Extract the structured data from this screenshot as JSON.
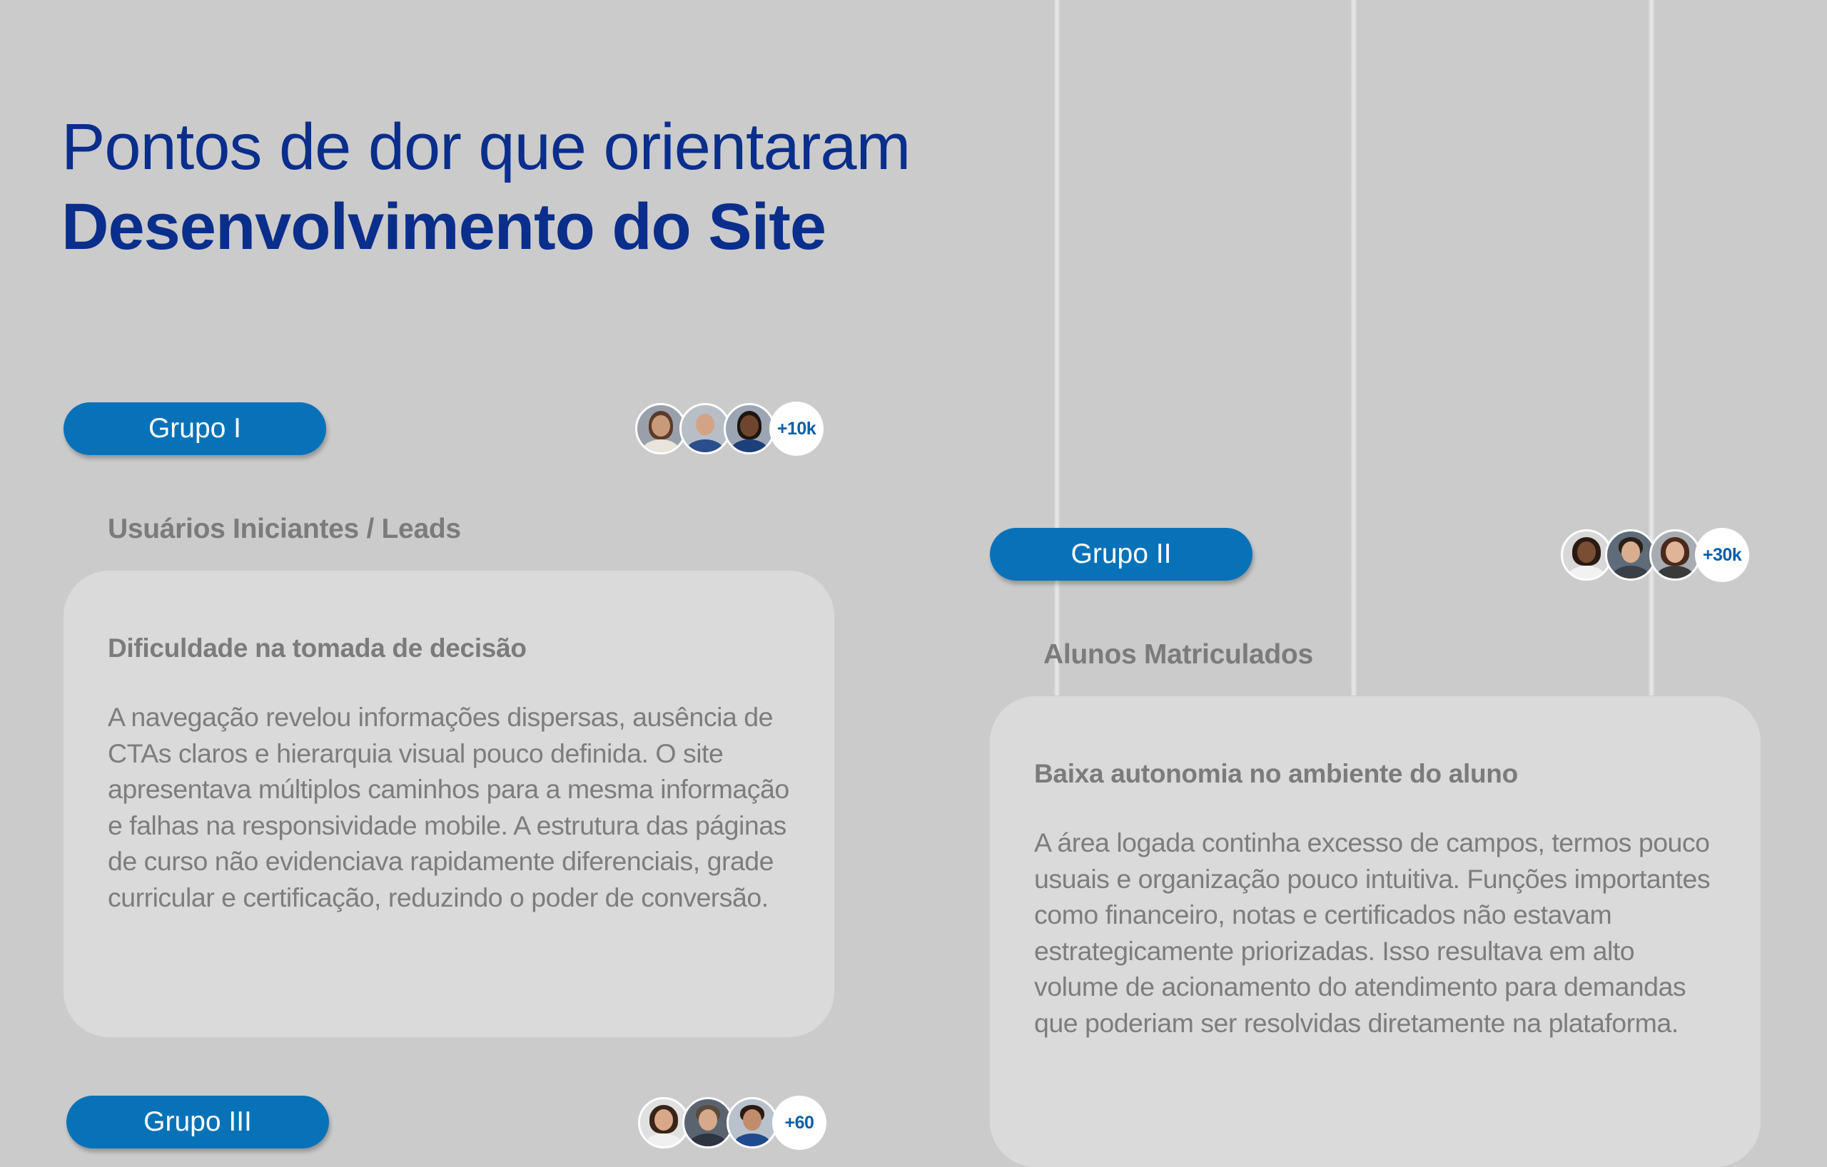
{
  "title": {
    "line1": "Pontos de dor que orientaram",
    "line2": "Desenvolvimento do Site"
  },
  "groups": [
    {
      "label": "Grupo I",
      "count": "+10k",
      "audience": "Usuários Iniciantes / Leads",
      "card_title": "Dificuldade na tomada de decisão",
      "card_body": "A navegação revelou informações dispersas, ausência de CTAs claros e hierarquia visual pouco definida. O site apresentava múltiplos caminhos para a mesma informação e falhas na responsividade mobile. A estrutura das páginas de curso não evidenciava rapidamente diferenciais, grade curricular e certificação, reduzindo o poder de conversão."
    },
    {
      "label": "Grupo II",
      "count": "+30k",
      "audience": "Alunos Matriculados",
      "card_title": "Baixa autonomia no ambiente do aluno",
      "card_body": "A área logada continha excesso de campos, termos pouco usuais e organização pouco intuitiva. Funções importantes como financeiro, notas e certificados não estavam estrategicamente priorizadas. Isso resultava em alto volume de acionamento do atendimento para demandas que poderiam ser resolvidas diretamente na plataforma."
    },
    {
      "label": "Grupo III",
      "count": "+60"
    }
  ],
  "colors": {
    "background": "#cbcbcb",
    "title": "#0a2e8c",
    "pill": "#0872b8",
    "card": "#dadada",
    "text": "#7b7b7b",
    "count": "#0a5fa8"
  }
}
